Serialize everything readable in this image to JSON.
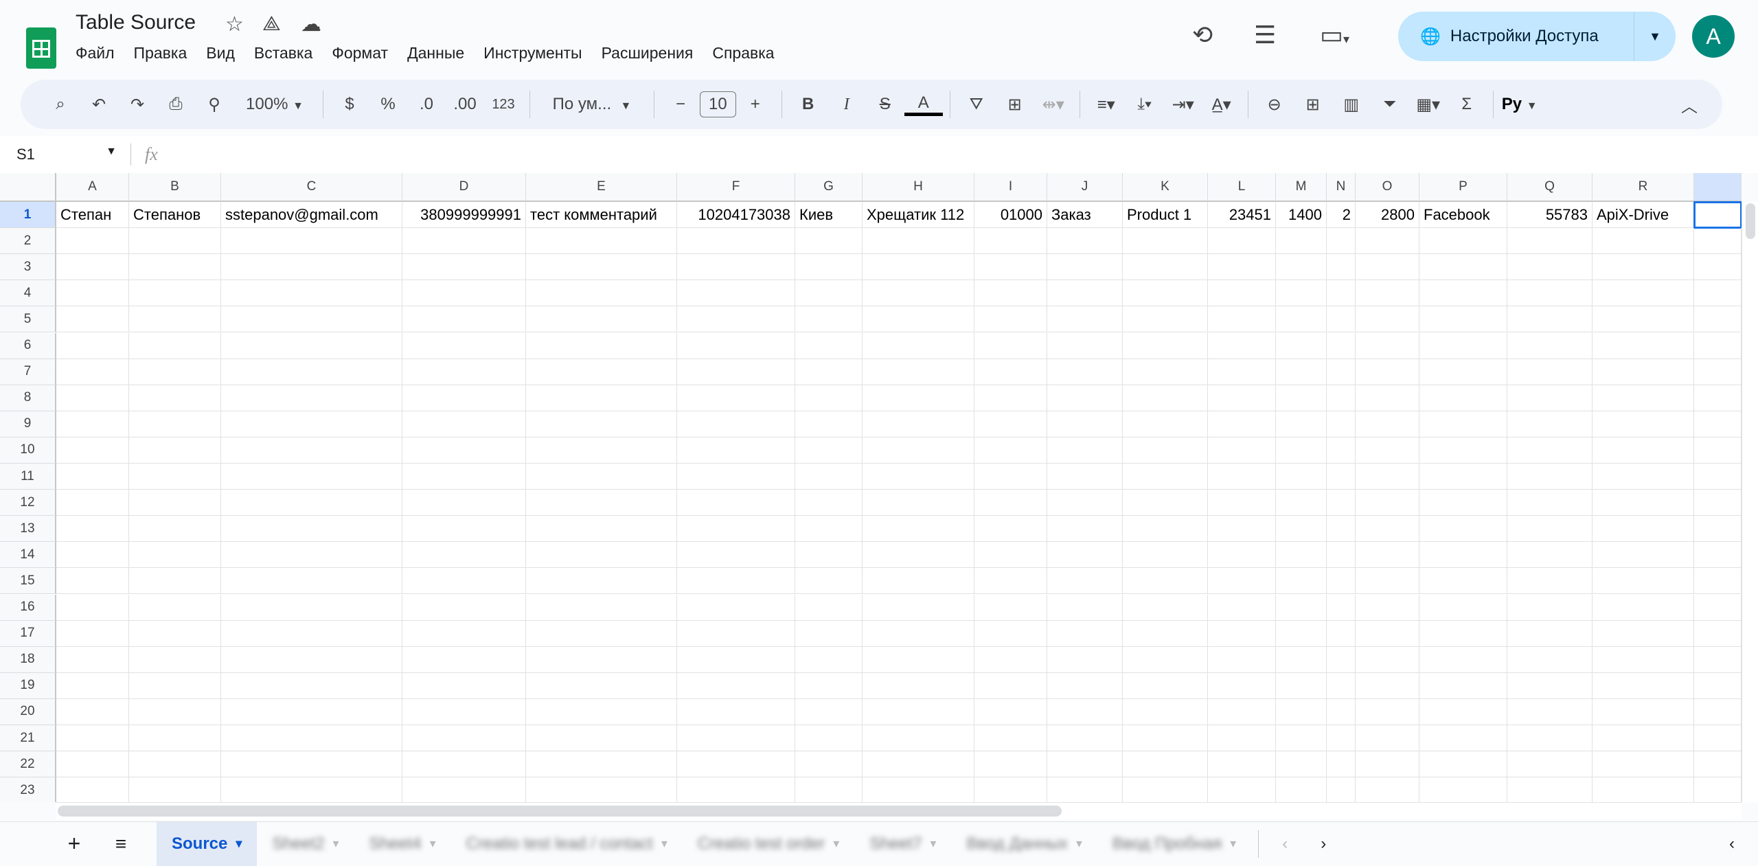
{
  "app": {
    "title": "Table Source",
    "menu": [
      "Файл",
      "Правка",
      "Вид",
      "Вставка",
      "Формат",
      "Данные",
      "Инструменты",
      "Расширения",
      "Справка"
    ],
    "share_label": "Настройки Доступа",
    "avatar_letter": "A"
  },
  "toolbar": {
    "zoom": "100%",
    "currency": "$",
    "percent": "%",
    "dec_decrease": ".0",
    "dec_increase": ".00",
    "number_format": "123",
    "font": "По ум...",
    "font_size": "10",
    "menu_lang": "Ру"
  },
  "formula_bar": {
    "cell_ref": "S1",
    "fx": "fx",
    "value": ""
  },
  "columns": [
    "A",
    "B",
    "C",
    "D",
    "E",
    "F",
    "G",
    "H",
    "I",
    "J",
    "K",
    "L",
    "M",
    "N",
    "O",
    "P",
    "Q",
    "R",
    ""
  ],
  "rows": [
    [
      "Степан",
      "Степанов",
      "sstepanov@gmail.com",
      "380999999991",
      "тест комментарий",
      "10204173038",
      "Киев",
      "Хрещатик 112",
      "01000",
      "Заказ",
      "Product 1",
      "23451",
      "1400",
      "2",
      "2800",
      "Facebook",
      "55783",
      "ApiX-Drive",
      ""
    ]
  ],
  "row_count": 23,
  "selected_cell": "S1",
  "sheets": [
    {
      "name": "Source",
      "active": true
    },
    {
      "name": "Sheet2"
    },
    {
      "name": "Sheet4"
    },
    {
      "name": "Creatio test lead / contact"
    },
    {
      "name": "Creatio test order"
    },
    {
      "name": "Sheet7"
    },
    {
      "name": "Ввод Данных"
    },
    {
      "name": "Ввод Пробная"
    }
  ],
  "colors": {
    "accent": "#0b57d0",
    "share_bg": "#c2e7ff",
    "avatar": "#00897b",
    "logo": "#0f9d58"
  }
}
